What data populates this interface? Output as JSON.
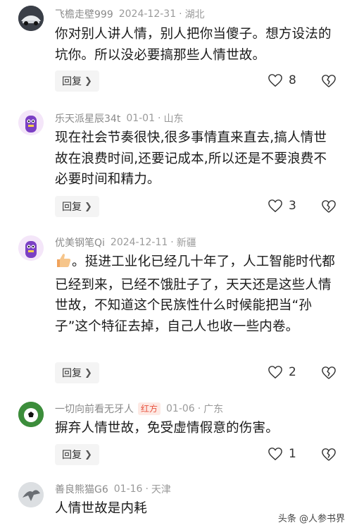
{
  "comments": [
    {
      "user": "飞檐走壁999",
      "date": "2024-12-31",
      "location": "湖北",
      "text": "你对别人讲人情，别人把你当傻子。想方设法的坑你。所以没必要搞那些人情世故。",
      "reply_label": "回复",
      "likes": "8",
      "avatar_icon": "car-avatar"
    },
    {
      "user": "乐天派星辰34t",
      "date": "01-01",
      "location": "山东",
      "text": "现在社会节奏很快,很多事情直来直去,搞人情世故在浪费时间,还要记成本,所以还是不要浪费不必要时间和精力。",
      "reply_label": "回复",
      "likes": "3",
      "avatar_icon": "purple-monster-avatar"
    },
    {
      "user": "优美钢笔Qi",
      "date": "2024-12-11",
      "location": "新疆",
      "text_prefix_icon": "thumbs-up-emoji",
      "text": "。挺进工业化已经几十年了，人工智能时代都已经到来，已经不饿肚子了，天天还是这些人情世故，不知道这个民族性什么时候能把当“孙子”这个特征去掉，自己人也收一些内卷。",
      "reply_label": "回复",
      "likes": "2",
      "avatar_icon": "purple-monster-avatar"
    },
    {
      "user": "一切向前看无牙人",
      "badge": "红方",
      "date": "01-06",
      "location": "广东",
      "text": "摒弃人情世故，免受虚情假意的伤害。",
      "reply_label": "回复",
      "likes": "1",
      "avatar_icon": "soccer-ball-avatar"
    },
    {
      "user": "善良熊猫G6",
      "date": "01-16",
      "location": "天津",
      "text": "人情世故是内耗",
      "avatar_icon": "bird-avatar"
    }
  ],
  "watermark": {
    "text": "头条 @人参书界"
  },
  "colors": {
    "badge_text": "#e8533f",
    "badge_bg": "#fde9e4",
    "meta_gray": "#9a9a9a",
    "button_bg": "#f4f4f4"
  }
}
